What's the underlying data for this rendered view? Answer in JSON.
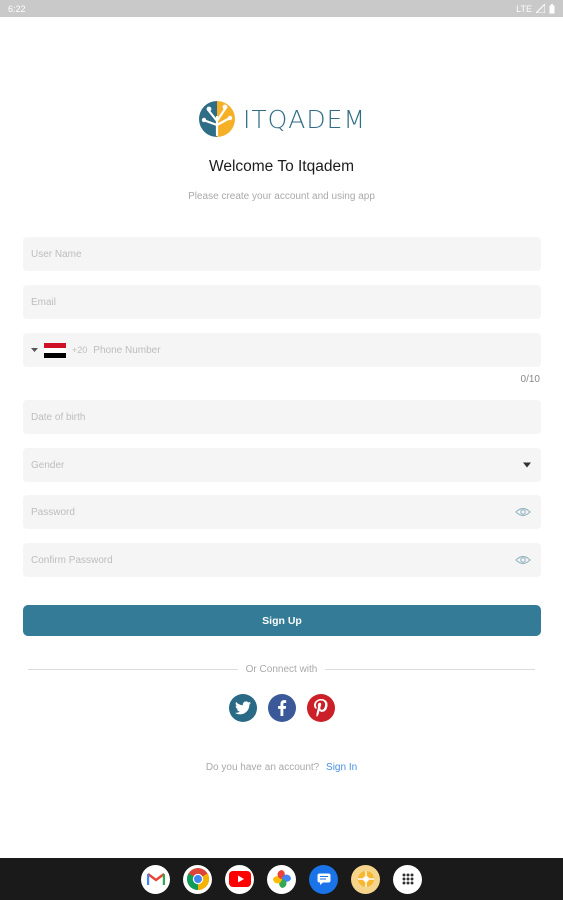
{
  "status": {
    "time": "6:22",
    "network": "LTE"
  },
  "logo": {
    "text": "ITQADEM"
  },
  "welcome": {
    "title": "Welcome To Itqadem",
    "subtitle": "Please create your account and using app"
  },
  "form": {
    "username_placeholder": "User Name",
    "email_placeholder": "Email",
    "phone_code": "+20",
    "phone_placeholder": "Phone Number",
    "phone_counter": "0/10",
    "dob_placeholder": "Date of birth",
    "gender_placeholder": "Gender",
    "password_placeholder": "Password",
    "confirm_password_placeholder": "Confirm Password"
  },
  "signup_label": "Sign Up",
  "connect_label": "Or Connect with",
  "socials": [
    "twitter-icon",
    "facebook-icon",
    "pinterest-icon"
  ],
  "signin_prompt": "Do you have an account?",
  "signin_link": "Sign In",
  "taskbar_apps": [
    "gmail-icon",
    "chrome-icon",
    "youtube-icon",
    "photos-icon",
    "messages-icon",
    "app-icon",
    "app-drawer-icon"
  ],
  "colors": {
    "primary": "#337b96",
    "twitter": "#2a6a86",
    "facebook": "#3b5998",
    "pinterest": "#cb2027",
    "link": "#4a90e2"
  }
}
